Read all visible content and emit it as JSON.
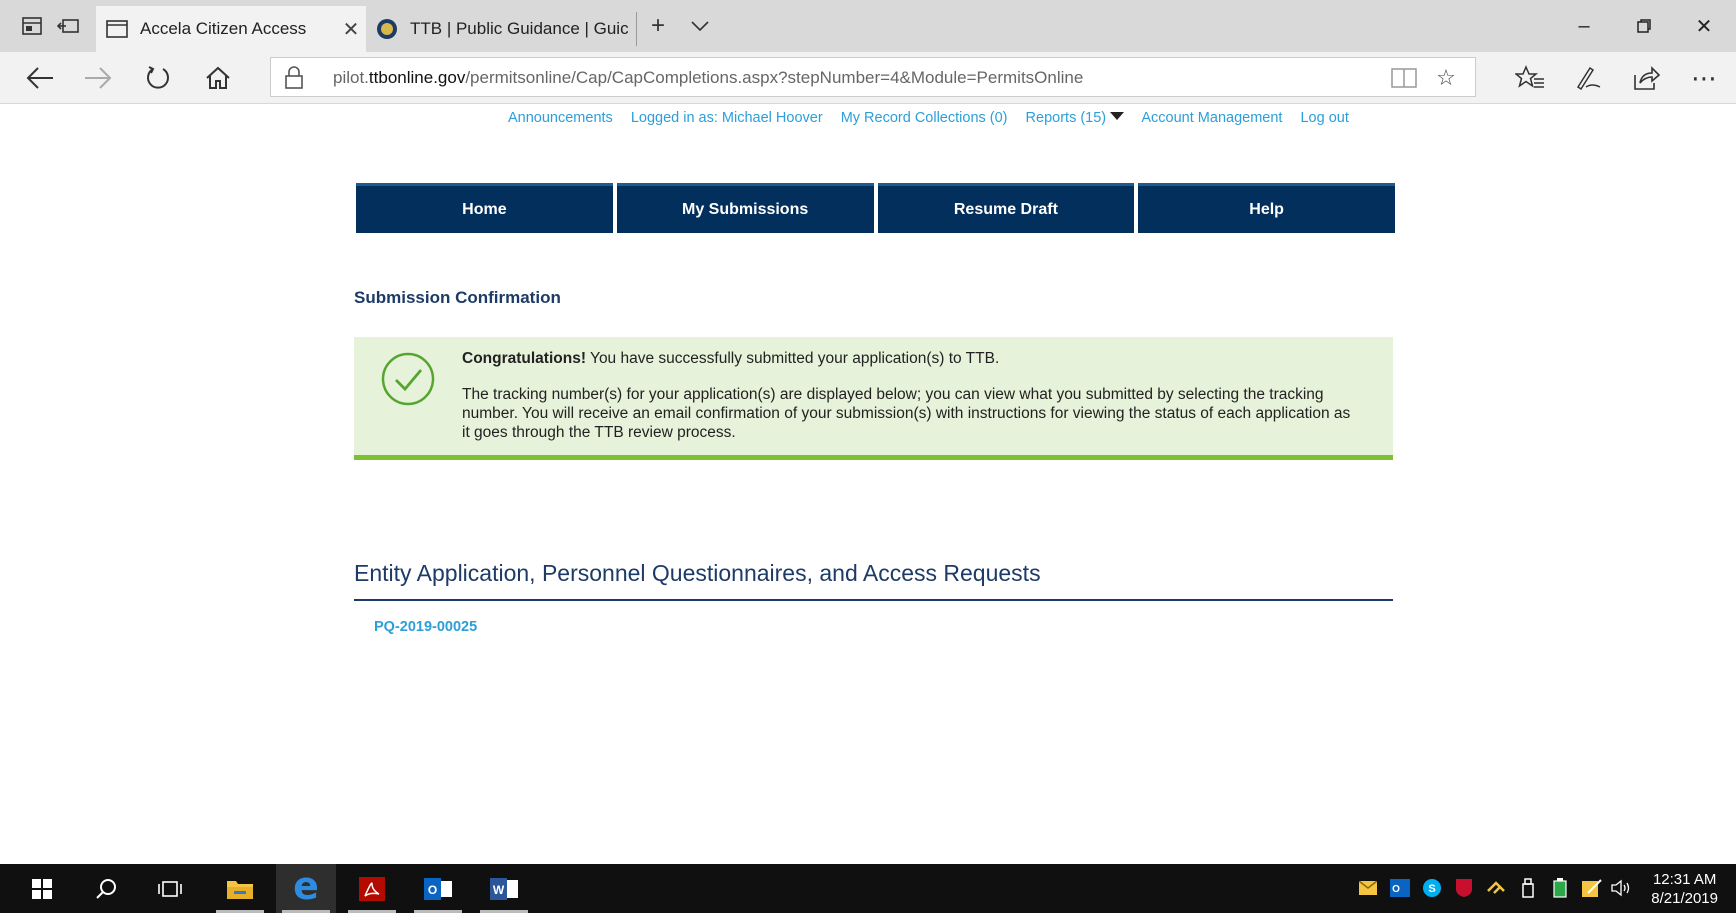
{
  "browser": {
    "tabs": [
      {
        "title": "Accela Citizen Access",
        "favicon": "window-icon",
        "active": true
      },
      {
        "title": "TTB | Public Guidance | Guic",
        "favicon": "ttb-seal-icon",
        "active": false
      }
    ],
    "url": {
      "prefix": "pilot.",
      "domain": "ttbonline.gov",
      "path": "/permitsonline/Cap/CapCompletions.aspx?stepNumber=4&Module=PermitsOnline"
    }
  },
  "topnav": {
    "announcements": "Announcements",
    "logged_in": "Logged in as: Michael Hoover",
    "collections": "My Record Collections (0)",
    "reports": "Reports (15)",
    "account": "Account Management",
    "logout": "Log out"
  },
  "mainnav": {
    "home": "Home",
    "submissions": "My Submissions",
    "resume": "Resume Draft",
    "help": "Help"
  },
  "confirmation": {
    "title": "Submission Confirmation",
    "congrats_bold": "Congratulations!",
    "congrats_text": " You have successfully submitted your application(s) to TTB.",
    "details": "The tracking number(s) for your application(s) are displayed below; you can view what you submitted by selecting the tracking number. You will receive an email confirmation of your submission(s) with instructions for viewing the status of each application as it goes through the TTB review process."
  },
  "section": {
    "title": "Entity Application, Personnel Questionnaires, and Access Requests",
    "records": [
      "PQ-2019-00025"
    ]
  },
  "taskbar": {
    "time": "12:31 AM",
    "date": "8/21/2019"
  },
  "colors": {
    "nav_bg": "#032f5c",
    "link": "#2c9fd9",
    "heading": "#1d3b66",
    "success_bg": "#e6f2d9",
    "success_border": "#7ac230"
  }
}
